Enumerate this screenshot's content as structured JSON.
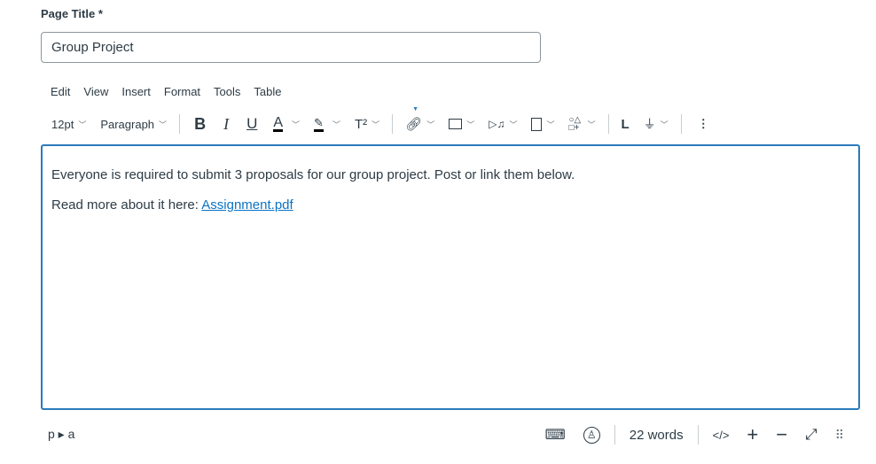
{
  "title_field": {
    "label": "Page Title",
    "required_mark": "*",
    "value": "Group Project"
  },
  "menubar": [
    "Edit",
    "View",
    "Insert",
    "Format",
    "Tools",
    "Table"
  ],
  "toolbar": {
    "font_size": "12pt",
    "block_format": "Paragraph",
    "bold": "B",
    "italic": "I",
    "underline": "U",
    "text_color": "A",
    "superscript": "T²"
  },
  "content": {
    "line1": "Everyone is required to submit 3 proposals for our group project. Post or link them below.",
    "line2_prefix": "Read more about it here: ",
    "link_text": "Assignment.pdf"
  },
  "statusbar": {
    "path": "p ▸ a",
    "word_count": "22 words",
    "html_toggle": "</>"
  },
  "colors": {
    "accent": "#2b7abc",
    "link": "#0b73c4"
  }
}
